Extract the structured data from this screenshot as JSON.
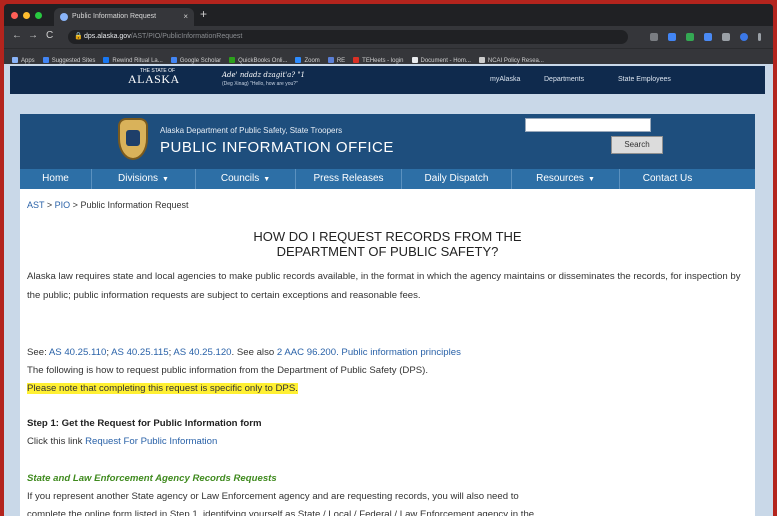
{
  "browser": {
    "tab_title": "Public Information Request",
    "tab_close": "×",
    "new_tab": "+",
    "url_host": "dps.alaska.gov",
    "url_path": "/AST/PIO/PublicInformationRequest",
    "back": "←",
    "forward": "→",
    "reload": "C",
    "bookmarks": [
      {
        "label": "Apps",
        "color": "#8ab4f8"
      },
      {
        "label": "Suggested Sites",
        "color": "#4285f4"
      },
      {
        "label": "Rewind Ritual La...",
        "color": "#1877f2"
      },
      {
        "label": "Google Scholar",
        "color": "#4285f4"
      },
      {
        "label": "QuickBooks Onli...",
        "color": "#2ca01c"
      },
      {
        "label": "Zoom",
        "color": "#2d8cff"
      },
      {
        "label": "RE",
        "color": "#5b7fd6"
      },
      {
        "label": "TEHeets - login",
        "color": "#d93025"
      },
      {
        "label": "Document - Hom...",
        "color": "#e8eaed"
      },
      {
        "label": "NCAI Policy Resea...",
        "color": "#cccccc"
      }
    ]
  },
  "state_bar": {
    "state_of": "THE STATE OF",
    "logo": "ALASKA",
    "tagline": "Ade' ndadz dzagit'a? \"1",
    "tagline_sub": "(Deg Xinag)   \"Hello, how are you?\"",
    "links": [
      "myAlaska",
      "Departments",
      "State Employees"
    ]
  },
  "header": {
    "agency": "Alaska Department of Public Safety, State Troopers",
    "office": "PUBLIC INFORMATION OFFICE",
    "search_button": "Search"
  },
  "nav": [
    {
      "label": "Home",
      "caret": ""
    },
    {
      "label": "Divisions",
      "caret": "▼"
    },
    {
      "label": "Councils",
      "caret": "▼"
    },
    {
      "label": "Press Releases",
      "caret": ""
    },
    {
      "label": "Daily Dispatch",
      "caret": ""
    },
    {
      "label": "Resources",
      "caret": "▼"
    },
    {
      "label": "Contact Us",
      "caret": ""
    }
  ],
  "breadcrumb": {
    "ast": "AST",
    "sep": ">",
    "pio": "PIO",
    "current": "Public Information Request"
  },
  "content": {
    "heading_line1": "HOW DO I REQUEST RECORDS FROM THE",
    "heading_line2": "DEPARTMENT OF PUBLIC SAFETY?",
    "intro": "Alaska law requires state and local agencies to make public records available, in the format in which the agency maintains or disseminates the records, for inspection by the public; public information requests are subject to certain exceptions and reasonable fees.",
    "see_prefix": "See: ",
    "link_as1": "AS 40.25.110",
    "link_as2": "AS 40.25.115",
    "link_as3": "AS 40.25.120",
    "see_also": ". See also ",
    "link_aac": "2 AAC 96.200.",
    "link_principles": "Public information principles",
    "following": "The following is how to request public information from the Department of Public Safety (DPS).",
    "note": "Please note that completing this request is specific only to DPS.",
    "step1_title": "Step 1: Get the Request for Public Information form",
    "step1_text": "Click this link ",
    "step1_link": "Request For Public Information",
    "agency_title": "State and Law Enforcement Agency Records Requests",
    "agency_text": "If you represent another State agency or Law Enforcement agency and are requesting records, you will also need to",
    "agency_text2": "complete the online form listed in Step 1, identifying yourself as State / Local / Federal / Law Enforcement agency in the..."
  }
}
